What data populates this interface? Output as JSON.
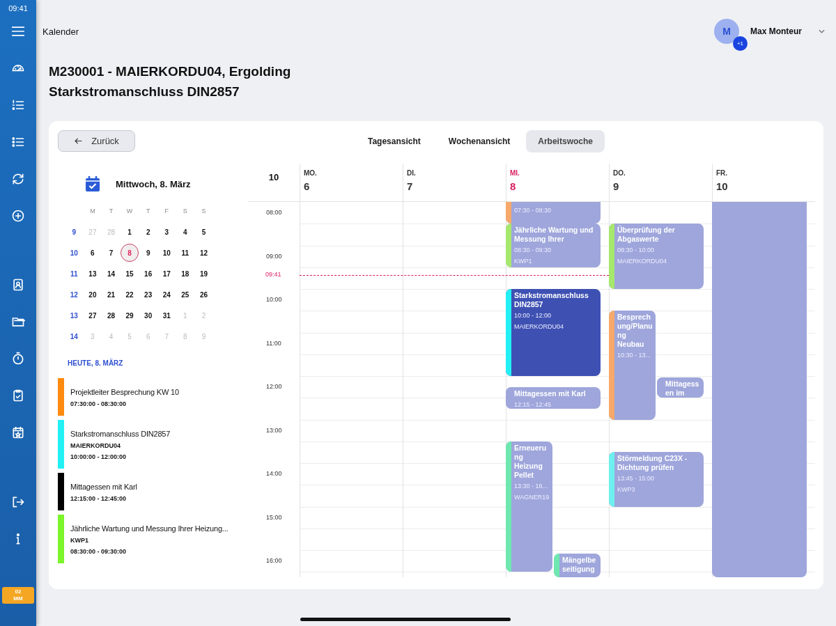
{
  "status_bar": {
    "time": "09:41"
  },
  "nav_badge": [
    "02",
    "MM"
  ],
  "header": {
    "title": "Kalender",
    "user": {
      "initial": "M",
      "name": "Max Monteur",
      "badge": "+1"
    }
  },
  "page_title": [
    "M230001 - MAIERKORDU04, Ergolding",
    "Starkstromanschluss DIN2857"
  ],
  "back_button": "Zurück",
  "view_tabs": [
    {
      "label": "Tagesansicht",
      "selected": false
    },
    {
      "label": "Wochenansicht",
      "selected": false
    },
    {
      "label": "Arbeitswoche",
      "selected": true
    }
  ],
  "mini_calendar": {
    "title": "Mittwoch, 8. März",
    "weekdays": [
      "M",
      "T",
      "W",
      "T",
      "F",
      "S",
      "S"
    ],
    "weeks": [
      {
        "week": "9",
        "days": [
          {
            "day": "27",
            "muted": true,
            "selected": false
          },
          {
            "day": "28",
            "muted": true,
            "selected": false
          },
          {
            "day": "1",
            "muted": false,
            "selected": false
          },
          {
            "day": "2",
            "muted": false,
            "selected": false
          },
          {
            "day": "3",
            "muted": false,
            "selected": false
          },
          {
            "day": "4",
            "muted": false,
            "selected": false
          },
          {
            "day": "5",
            "muted": false,
            "selected": false
          }
        ]
      },
      {
        "week": "10",
        "days": [
          {
            "day": "6",
            "muted": false,
            "selected": false
          },
          {
            "day": "7",
            "muted": false,
            "selected": false
          },
          {
            "day": "8",
            "muted": false,
            "selected": true
          },
          {
            "day": "9",
            "muted": false,
            "selected": false
          },
          {
            "day": "10",
            "muted": false,
            "selected": false
          },
          {
            "day": "11",
            "muted": false,
            "selected": false
          },
          {
            "day": "12",
            "muted": false,
            "selected": false
          }
        ]
      },
      {
        "week": "11",
        "days": [
          {
            "day": "13",
            "muted": false,
            "selected": false
          },
          {
            "day": "14",
            "muted": false,
            "selected": false
          },
          {
            "day": "15",
            "muted": false,
            "selected": false
          },
          {
            "day": "16",
            "muted": false,
            "selected": false
          },
          {
            "day": "17",
            "muted": false,
            "selected": false
          },
          {
            "day": "18",
            "muted": false,
            "selected": false
          },
          {
            "day": "19",
            "muted": false,
            "selected": false
          }
        ]
      },
      {
        "week": "12",
        "days": [
          {
            "day": "20",
            "muted": false,
            "selected": false
          },
          {
            "day": "21",
            "muted": false,
            "selected": false
          },
          {
            "day": "22",
            "muted": false,
            "selected": false
          },
          {
            "day": "23",
            "muted": false,
            "selected": false
          },
          {
            "day": "24",
            "muted": false,
            "selected": false
          },
          {
            "day": "25",
            "muted": false,
            "selected": false
          },
          {
            "day": "26",
            "muted": false,
            "selected": false
          }
        ]
      },
      {
        "week": "13",
        "days": [
          {
            "day": "27",
            "muted": false,
            "selected": false
          },
          {
            "day": "28",
            "muted": false,
            "selected": false
          },
          {
            "day": "29",
            "muted": false,
            "selected": false
          },
          {
            "day": "30",
            "muted": false,
            "selected": false
          },
          {
            "day": "31",
            "muted": false,
            "selected": false
          },
          {
            "day": "1",
            "muted": true,
            "selected": false
          },
          {
            "day": "2",
            "muted": true,
            "selected": false
          }
        ]
      },
      {
        "week": "14",
        "days": [
          {
            "day": "3",
            "muted": true,
            "selected": false
          },
          {
            "day": "4",
            "muted": true,
            "selected": false
          },
          {
            "day": "5",
            "muted": true,
            "selected": false
          },
          {
            "day": "6",
            "muted": true,
            "selected": false
          },
          {
            "day": "7",
            "muted": true,
            "selected": false
          },
          {
            "day": "8",
            "muted": true,
            "selected": false
          },
          {
            "day": "9",
            "muted": true,
            "selected": false
          }
        ]
      }
    ]
  },
  "today_heading": "HEUTE, 8. MÄRZ",
  "agenda": [
    {
      "title": "Projektleiter Besprechung KW 10",
      "time": "07:30:00 - 08:30:00",
      "color": "#ff8a10"
    },
    {
      "title": "Starkstromanschluss DIN2857",
      "customer": "MAIERKORDU04",
      "time": "10:00:00 - 12:00:00",
      "color": "#22f0f5"
    },
    {
      "title": "Mittagessen mit Karl",
      "time": "12:15:00 - 12:45:00",
      "color": "#000000"
    },
    {
      "title": "Jährliche Wartung und Messung Ihrer Heizung...",
      "customer": "KWP1",
      "time": "08:30:00 - 09:30:00",
      "color": "#7cf52a"
    }
  ],
  "week": {
    "number": "10",
    "days": [
      {
        "name": "MO.",
        "date": "6",
        "today": false
      },
      {
        "name": "DI.",
        "date": "7",
        "today": false
      },
      {
        "name": "MI.",
        "date": "8",
        "today": true,
        "events": [
          {
            "time": "07:30 - 08:30",
            "color": "#f6a96a",
            "selected": false
          },
          {
            "title": "Jährliche Wartung und Messung Ihrer",
            "time": "08:30 - 09:30",
            "customer": "KWP1",
            "color": "#a6e86e",
            "selected": false
          },
          {
            "title": "Starkstromanschluss DIN2857",
            "time": "10:00 - 12:00",
            "customer": "MAIERKORDU04",
            "color": "#22f0f5",
            "selected": true
          },
          {
            "title": "Mittagessen mit Karl",
            "time": "12:15 - 12:45",
            "color": "#9ea6db",
            "selected": false
          },
          {
            "title": "Erneuerung Heizung Pellet",
            "time": "13:30 - 16...",
            "customer": "WAGNER19",
            "color": "#6ee8b0",
            "selected": false
          },
          {
            "title": "Mängelbeseitigung",
            "color": "#6ee8b0",
            "selected": false
          }
        ]
      },
      {
        "name": "DO.",
        "date": "9",
        "today": false,
        "events": [
          {
            "title": "Überprüfung der Abgaswerte",
            "time": "08:30 - 10:00",
            "customer": "MAIERKORDU04",
            "color": "#a6e86e",
            "selected": false
          },
          {
            "title": "Besprechung/Planung Neubau",
            "time": "10:30 - 13...",
            "color": "#f6a96a",
            "selected": false
          },
          {
            "title": "Mittagessen im",
            "color": "#9ea6db",
            "selected": false
          },
          {
            "title": "Störmeldung C23X - Dichtung prüfen",
            "time": "13:45 - 15:00",
            "customer": "KWP3",
            "color": "#6ef0ee",
            "selected": false
          }
        ]
      },
      {
        "name": "FR.",
        "date": "10",
        "today": false,
        "events": [
          {
            "selected": false
          }
        ]
      }
    ],
    "hours": [
      "08:00",
      "09:00",
      "10:00",
      "11:00",
      "12:00",
      "13:00",
      "14:00",
      "15:00",
      "16:00"
    ],
    "now": "09:41"
  }
}
